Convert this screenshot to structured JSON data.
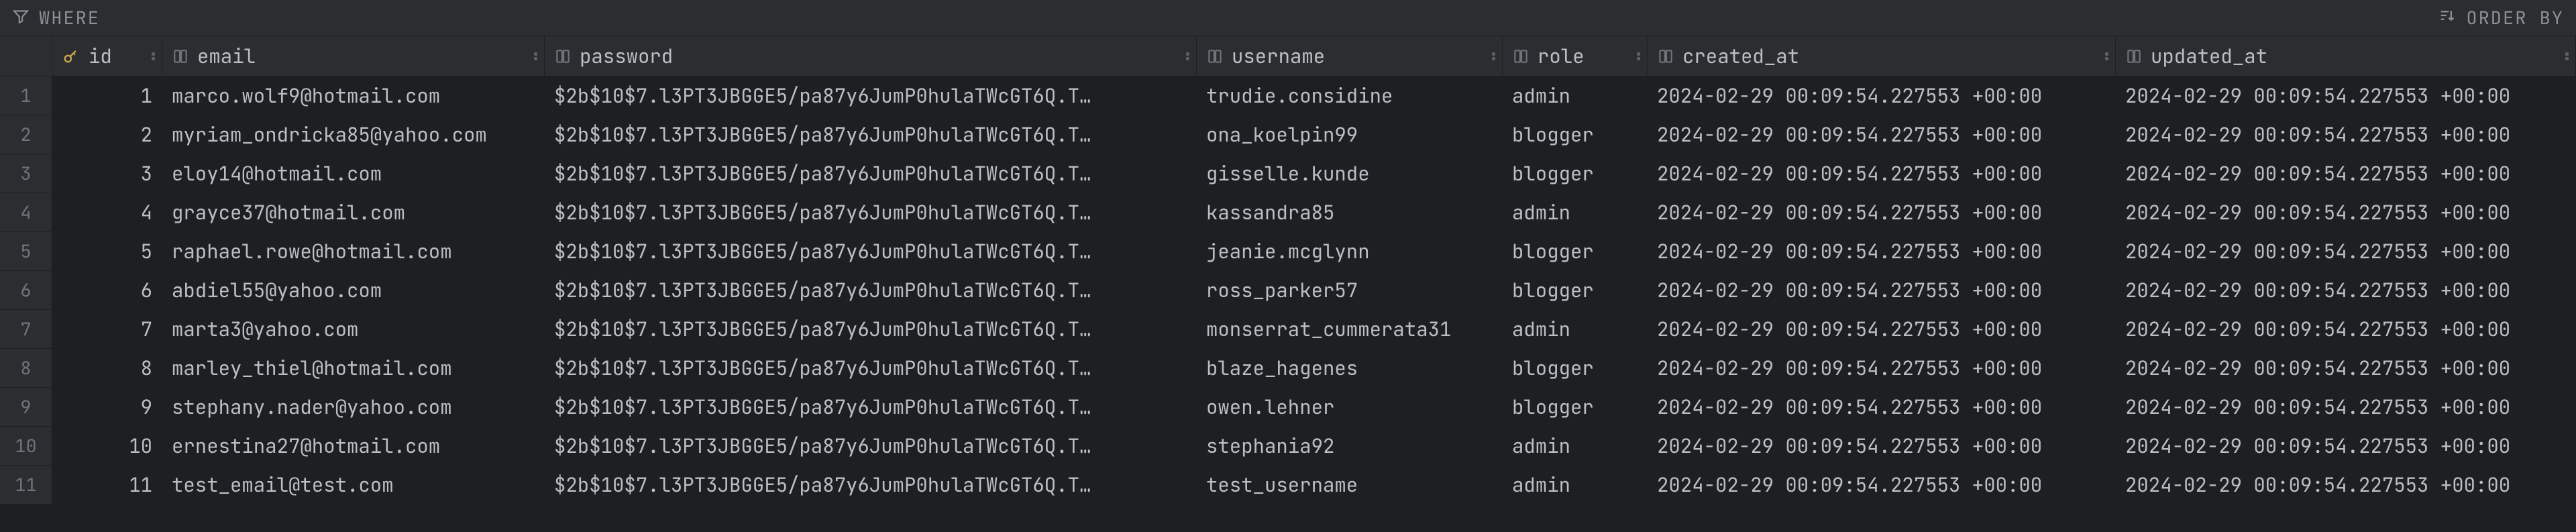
{
  "toolbar": {
    "where_label": "WHERE",
    "orderby_label": "ORDER BY"
  },
  "columns": [
    {
      "key": "id",
      "label": "id"
    },
    {
      "key": "email",
      "label": "email"
    },
    {
      "key": "password",
      "label": "password"
    },
    {
      "key": "username",
      "label": "username"
    },
    {
      "key": "role",
      "label": "role"
    },
    {
      "key": "created_at",
      "label": "created_at"
    },
    {
      "key": "updated_at",
      "label": "updated_at"
    }
  ],
  "rows": [
    {
      "n": "1",
      "id": "1",
      "email": "marco.wolf9@hotmail.com",
      "password": "$2b$10$7.l3PT3JBGGE5/pa87y6JumP0hulaTWcGT6Q.T…",
      "username": "trudie.considine",
      "role": "admin",
      "created_at": "2024-02-29 00:09:54.227553 +00:00",
      "updated_at": "2024-02-29 00:09:54.227553 +00:00"
    },
    {
      "n": "2",
      "id": "2",
      "email": "myriam_ondricka85@yahoo.com",
      "password": "$2b$10$7.l3PT3JBGGE5/pa87y6JumP0hulaTWcGT6Q.T…",
      "username": "ona_koelpin99",
      "role": "blogger",
      "created_at": "2024-02-29 00:09:54.227553 +00:00",
      "updated_at": "2024-02-29 00:09:54.227553 +00:00"
    },
    {
      "n": "3",
      "id": "3",
      "email": "eloy14@hotmail.com",
      "password": "$2b$10$7.l3PT3JBGGE5/pa87y6JumP0hulaTWcGT6Q.T…",
      "username": "gisselle.kunde",
      "role": "blogger",
      "created_at": "2024-02-29 00:09:54.227553 +00:00",
      "updated_at": "2024-02-29 00:09:54.227553 +00:00"
    },
    {
      "n": "4",
      "id": "4",
      "email": "grayce37@hotmail.com",
      "password": "$2b$10$7.l3PT3JBGGE5/pa87y6JumP0hulaTWcGT6Q.T…",
      "username": "kassandra85",
      "role": "admin",
      "created_at": "2024-02-29 00:09:54.227553 +00:00",
      "updated_at": "2024-02-29 00:09:54.227553 +00:00"
    },
    {
      "n": "5",
      "id": "5",
      "email": "raphael.rowe@hotmail.com",
      "password": "$2b$10$7.l3PT3JBGGE5/pa87y6JumP0hulaTWcGT6Q.T…",
      "username": "jeanie.mcglynn",
      "role": "blogger",
      "created_at": "2024-02-29 00:09:54.227553 +00:00",
      "updated_at": "2024-02-29 00:09:54.227553 +00:00"
    },
    {
      "n": "6",
      "id": "6",
      "email": "abdiel55@yahoo.com",
      "password": "$2b$10$7.l3PT3JBGGE5/pa87y6JumP0hulaTWcGT6Q.T…",
      "username": "ross_parker57",
      "role": "blogger",
      "created_at": "2024-02-29 00:09:54.227553 +00:00",
      "updated_at": "2024-02-29 00:09:54.227553 +00:00"
    },
    {
      "n": "7",
      "id": "7",
      "email": "marta3@yahoo.com",
      "password": "$2b$10$7.l3PT3JBGGE5/pa87y6JumP0hulaTWcGT6Q.T…",
      "username": "monserrat_cummerata31",
      "role": "admin",
      "created_at": "2024-02-29 00:09:54.227553 +00:00",
      "updated_at": "2024-02-29 00:09:54.227553 +00:00"
    },
    {
      "n": "8",
      "id": "8",
      "email": "marley_thiel@hotmail.com",
      "password": "$2b$10$7.l3PT3JBGGE5/pa87y6JumP0hulaTWcGT6Q.T…",
      "username": "blaze_hagenes",
      "role": "blogger",
      "created_at": "2024-02-29 00:09:54.227553 +00:00",
      "updated_at": "2024-02-29 00:09:54.227553 +00:00"
    },
    {
      "n": "9",
      "id": "9",
      "email": "stephany.nader@yahoo.com",
      "password": "$2b$10$7.l3PT3JBGGE5/pa87y6JumP0hulaTWcGT6Q.T…",
      "username": "owen.lehner",
      "role": "blogger",
      "created_at": "2024-02-29 00:09:54.227553 +00:00",
      "updated_at": "2024-02-29 00:09:54.227553 +00:00"
    },
    {
      "n": "10",
      "id": "10",
      "email": "ernestina27@hotmail.com",
      "password": "$2b$10$7.l3PT3JBGGE5/pa87y6JumP0hulaTWcGT6Q.T…",
      "username": "stephania92",
      "role": "admin",
      "created_at": "2024-02-29 00:09:54.227553 +00:00",
      "updated_at": "2024-02-29 00:09:54.227553 +00:00"
    },
    {
      "n": "11",
      "id": "11",
      "email": "test_email@test.com",
      "password": "$2b$10$7.l3PT3JBGGE5/pa87y6JumP0hulaTWcGT6Q.T…",
      "username": "test_username",
      "role": "admin",
      "created_at": "2024-02-29 00:09:54.227553 +00:00",
      "updated_at": "2024-02-29 00:09:54.227553 +00:00"
    }
  ]
}
